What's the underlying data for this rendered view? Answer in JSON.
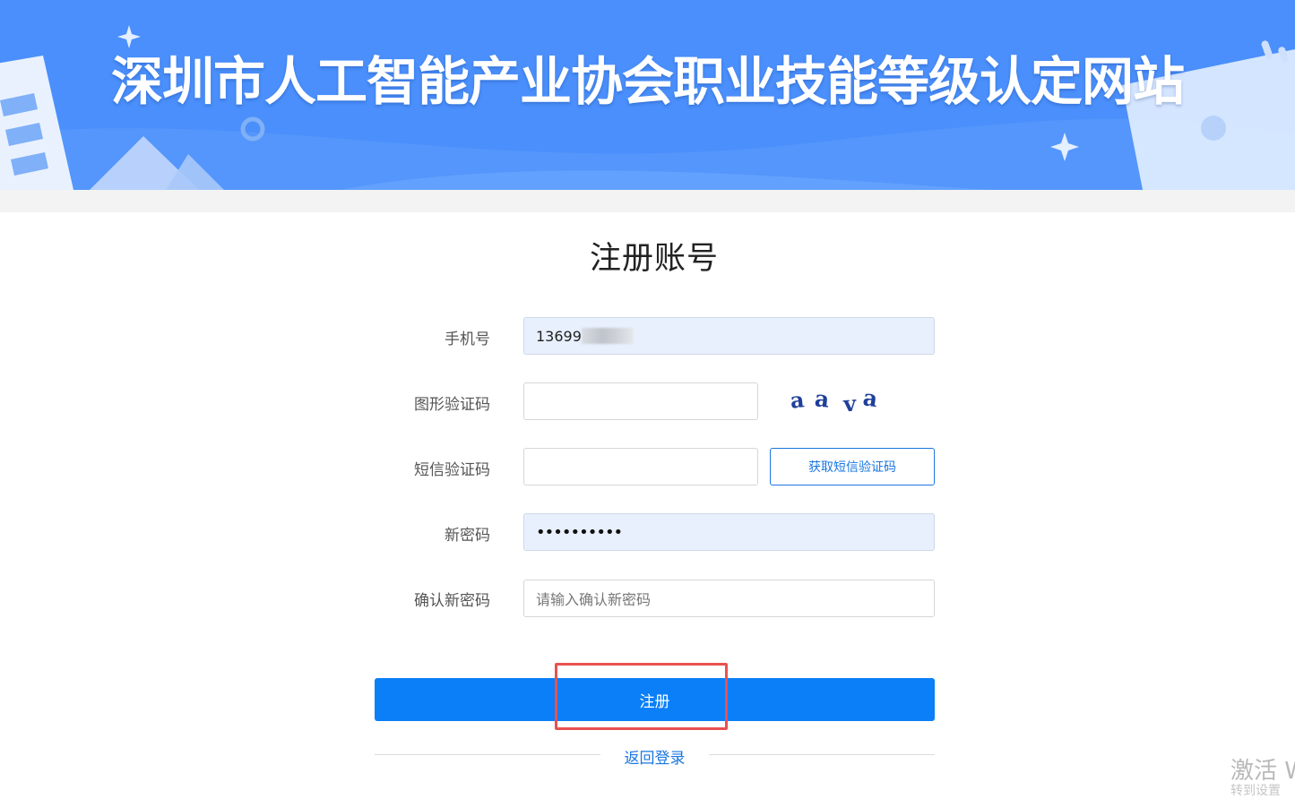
{
  "header": {
    "site_title": "深圳市人工智能产业协会职业技能等级认定网站"
  },
  "form": {
    "title": "注册账号",
    "phone": {
      "label": "手机号",
      "value": "13699"
    },
    "captcha": {
      "label": "图形验证码",
      "value": "",
      "image_text": "aava"
    },
    "sms_code": {
      "label": "短信验证码",
      "value": "",
      "button_label": "获取短信验证码"
    },
    "new_password": {
      "label": "新密码",
      "value": "••••••••••"
    },
    "confirm_password": {
      "label": "确认新密码",
      "placeholder": "请输入确认新密码"
    },
    "submit_label": "注册",
    "back_to_login": "返回登录"
  },
  "os_watermark": {
    "text": "激活 W",
    "sub": "转到设置"
  },
  "colors": {
    "banner": "#4a8ffb",
    "primary_button": "#0a7ff8",
    "link": "#1a77e0",
    "highlight_box": "#e8524f",
    "autofill_bg": "#e8f0fe"
  }
}
